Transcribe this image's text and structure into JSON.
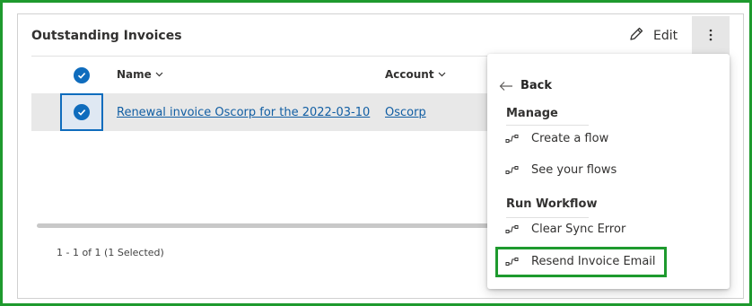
{
  "card": {
    "title": "Outstanding Invoices",
    "edit_label": "Edit"
  },
  "grid": {
    "columns": [
      {
        "label": "Name"
      },
      {
        "label": "Account"
      }
    ],
    "rows": [
      {
        "name": "Renewal invoice Oscorp for the 2022-03-10",
        "account": "Oscorp",
        "selected": true
      }
    ],
    "footer": "1 - 1 of 1 (1 Selected)"
  },
  "flyout": {
    "back_label": "Back",
    "sections": [
      {
        "header": "Manage",
        "items": [
          {
            "label": "Create a flow"
          },
          {
            "label": "See your flows"
          }
        ]
      },
      {
        "header": "Run Workflow",
        "items": [
          {
            "label": "Clear Sync Error"
          },
          {
            "label": "Resend Invoice Email"
          }
        ]
      }
    ]
  },
  "colors": {
    "accent": "#0f6cbd",
    "link": "#115ea3",
    "highlight": "#1e9a2e",
    "selected_row": "#e8e8e8"
  }
}
